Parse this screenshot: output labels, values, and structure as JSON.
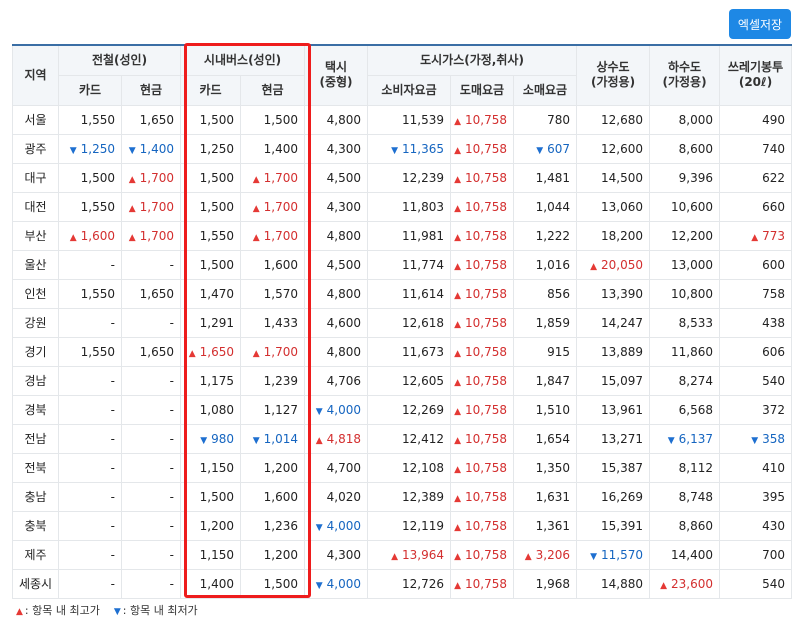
{
  "toolbar": {
    "excel_label": "엑셀저장"
  },
  "headers": {
    "region": "지역",
    "subway": "전철(성인)",
    "bus": "시내버스(성인)",
    "taxi": "택시\n(중형)",
    "gas": "도시가스(가정,취사)",
    "water": "상수도\n(가정용)",
    "sewer": "하수도\n(가정용)",
    "trash": "쓰레기봉투\n(20ℓ)",
    "card": "카드",
    "cash": "현금",
    "gas_consumer": "소비자요금",
    "gas_wholesale": "도매요금",
    "gas_retail": "소매요금"
  },
  "rows": [
    {
      "region": "서울",
      "cells": [
        {
          "v": "1,550"
        },
        {
          "v": "1,650"
        },
        {
          "v": "1,500"
        },
        {
          "v": "1,500"
        },
        {
          "v": "4,800"
        },
        {
          "v": "11,539"
        },
        {
          "v": "10,758",
          "m": "up"
        },
        {
          "v": "780"
        },
        {
          "v": "12,680"
        },
        {
          "v": "8,000"
        },
        {
          "v": "490"
        }
      ]
    },
    {
      "region": "광주",
      "cells": [
        {
          "v": "1,250",
          "m": "down"
        },
        {
          "v": "1,400",
          "m": "down"
        },
        {
          "v": "1,250"
        },
        {
          "v": "1,400"
        },
        {
          "v": "4,300"
        },
        {
          "v": "11,365",
          "m": "down"
        },
        {
          "v": "10,758",
          "m": "up"
        },
        {
          "v": "607",
          "m": "down"
        },
        {
          "v": "12,600"
        },
        {
          "v": "8,600"
        },
        {
          "v": "740"
        }
      ]
    },
    {
      "region": "대구",
      "cells": [
        {
          "v": "1,500"
        },
        {
          "v": "1,700",
          "m": "up"
        },
        {
          "v": "1,500"
        },
        {
          "v": "1,700",
          "m": "up"
        },
        {
          "v": "4,500"
        },
        {
          "v": "12,239"
        },
        {
          "v": "10,758",
          "m": "up"
        },
        {
          "v": "1,481"
        },
        {
          "v": "14,500"
        },
        {
          "v": "9,396"
        },
        {
          "v": "622"
        }
      ]
    },
    {
      "region": "대전",
      "cells": [
        {
          "v": "1,550"
        },
        {
          "v": "1,700",
          "m": "up"
        },
        {
          "v": "1,500"
        },
        {
          "v": "1,700",
          "m": "up"
        },
        {
          "v": "4,300"
        },
        {
          "v": "11,803"
        },
        {
          "v": "10,758",
          "m": "up"
        },
        {
          "v": "1,044"
        },
        {
          "v": "13,060"
        },
        {
          "v": "10,600"
        },
        {
          "v": "660"
        }
      ]
    },
    {
      "region": "부산",
      "cells": [
        {
          "v": "1,600",
          "m": "up"
        },
        {
          "v": "1,700",
          "m": "up"
        },
        {
          "v": "1,550"
        },
        {
          "v": "1,700",
          "m": "up"
        },
        {
          "v": "4,800"
        },
        {
          "v": "11,981"
        },
        {
          "v": "10,758",
          "m": "up"
        },
        {
          "v": "1,222"
        },
        {
          "v": "18,200"
        },
        {
          "v": "12,200"
        },
        {
          "v": "773",
          "m": "up"
        }
      ]
    },
    {
      "region": "울산",
      "cells": [
        {
          "v": "-"
        },
        {
          "v": "-"
        },
        {
          "v": "1,500"
        },
        {
          "v": "1,600"
        },
        {
          "v": "4,500"
        },
        {
          "v": "11,774"
        },
        {
          "v": "10,758",
          "m": "up"
        },
        {
          "v": "1,016"
        },
        {
          "v": "20,050",
          "m": "up"
        },
        {
          "v": "13,000"
        },
        {
          "v": "600"
        }
      ]
    },
    {
      "region": "인천",
      "cells": [
        {
          "v": "1,550"
        },
        {
          "v": "1,650"
        },
        {
          "v": "1,470"
        },
        {
          "v": "1,570"
        },
        {
          "v": "4,800"
        },
        {
          "v": "11,614"
        },
        {
          "v": "10,758",
          "m": "up"
        },
        {
          "v": "856"
        },
        {
          "v": "13,390"
        },
        {
          "v": "10,800"
        },
        {
          "v": "758"
        }
      ]
    },
    {
      "region": "강원",
      "cells": [
        {
          "v": "-"
        },
        {
          "v": "-"
        },
        {
          "v": "1,291"
        },
        {
          "v": "1,433"
        },
        {
          "v": "4,600"
        },
        {
          "v": "12,618"
        },
        {
          "v": "10,758",
          "m": "up"
        },
        {
          "v": "1,859"
        },
        {
          "v": "14,247"
        },
        {
          "v": "8,533"
        },
        {
          "v": "438"
        }
      ]
    },
    {
      "region": "경기",
      "cells": [
        {
          "v": "1,550"
        },
        {
          "v": "1,650"
        },
        {
          "v": "1,650",
          "m": "up"
        },
        {
          "v": "1,700",
          "m": "up"
        },
        {
          "v": "4,800"
        },
        {
          "v": "11,673"
        },
        {
          "v": "10,758",
          "m": "up"
        },
        {
          "v": "915"
        },
        {
          "v": "13,889"
        },
        {
          "v": "11,860"
        },
        {
          "v": "606"
        }
      ]
    },
    {
      "region": "경남",
      "cells": [
        {
          "v": "-"
        },
        {
          "v": "-"
        },
        {
          "v": "1,175"
        },
        {
          "v": "1,239"
        },
        {
          "v": "4,706"
        },
        {
          "v": "12,605"
        },
        {
          "v": "10,758",
          "m": "up"
        },
        {
          "v": "1,847"
        },
        {
          "v": "15,097"
        },
        {
          "v": "8,274"
        },
        {
          "v": "540"
        }
      ]
    },
    {
      "region": "경북",
      "cells": [
        {
          "v": "-"
        },
        {
          "v": "-"
        },
        {
          "v": "1,080"
        },
        {
          "v": "1,127"
        },
        {
          "v": "4,000",
          "m": "down"
        },
        {
          "v": "12,269"
        },
        {
          "v": "10,758",
          "m": "up"
        },
        {
          "v": "1,510"
        },
        {
          "v": "13,961"
        },
        {
          "v": "6,568"
        },
        {
          "v": "372"
        }
      ]
    },
    {
      "region": "전남",
      "cells": [
        {
          "v": "-"
        },
        {
          "v": "-"
        },
        {
          "v": "980",
          "m": "down"
        },
        {
          "v": "1,014",
          "m": "down"
        },
        {
          "v": "4,818",
          "m": "up"
        },
        {
          "v": "12,412"
        },
        {
          "v": "10,758",
          "m": "up"
        },
        {
          "v": "1,654"
        },
        {
          "v": "13,271"
        },
        {
          "v": "6,137",
          "m": "down"
        },
        {
          "v": "358",
          "m": "down"
        }
      ]
    },
    {
      "region": "전북",
      "cells": [
        {
          "v": "-"
        },
        {
          "v": "-"
        },
        {
          "v": "1,150"
        },
        {
          "v": "1,200"
        },
        {
          "v": "4,700"
        },
        {
          "v": "12,108"
        },
        {
          "v": "10,758",
          "m": "up"
        },
        {
          "v": "1,350"
        },
        {
          "v": "15,387"
        },
        {
          "v": "8,112"
        },
        {
          "v": "410"
        }
      ]
    },
    {
      "region": "충남",
      "cells": [
        {
          "v": "-"
        },
        {
          "v": "-"
        },
        {
          "v": "1,500"
        },
        {
          "v": "1,600"
        },
        {
          "v": "4,020"
        },
        {
          "v": "12,389"
        },
        {
          "v": "10,758",
          "m": "up"
        },
        {
          "v": "1,631"
        },
        {
          "v": "16,269"
        },
        {
          "v": "8,748"
        },
        {
          "v": "395"
        }
      ]
    },
    {
      "region": "충북",
      "cells": [
        {
          "v": "-"
        },
        {
          "v": "-"
        },
        {
          "v": "1,200"
        },
        {
          "v": "1,236"
        },
        {
          "v": "4,000",
          "m": "down"
        },
        {
          "v": "12,119"
        },
        {
          "v": "10,758",
          "m": "up"
        },
        {
          "v": "1,361"
        },
        {
          "v": "15,391"
        },
        {
          "v": "8,860"
        },
        {
          "v": "430"
        }
      ]
    },
    {
      "region": "제주",
      "cells": [
        {
          "v": "-"
        },
        {
          "v": "-"
        },
        {
          "v": "1,150"
        },
        {
          "v": "1,200"
        },
        {
          "v": "4,300"
        },
        {
          "v": "13,964",
          "m": "up"
        },
        {
          "v": "10,758",
          "m": "up"
        },
        {
          "v": "3,206",
          "m": "up"
        },
        {
          "v": "11,570",
          "m": "down"
        },
        {
          "v": "14,400"
        },
        {
          "v": "700"
        }
      ]
    },
    {
      "region": "세종시",
      "cells": [
        {
          "v": "-"
        },
        {
          "v": "-"
        },
        {
          "v": "1,400"
        },
        {
          "v": "1,500"
        },
        {
          "v": "4,000",
          "m": "down"
        },
        {
          "v": "12,726"
        },
        {
          "v": "10,758",
          "m": "up"
        },
        {
          "v": "1,968"
        },
        {
          "v": "14,880"
        },
        {
          "v": "23,600",
          "m": "up"
        },
        {
          "v": "540"
        }
      ]
    }
  ],
  "legend": {
    "up_label": ": 항목 내 최고가",
    "down_label": ": 항목 내 최저가"
  },
  "colors": {
    "accent": "#1e88e5",
    "high": "#d32f2f",
    "low": "#1565c0",
    "highlight": "#ee1c1c"
  },
  "icons": {
    "up": "triangle-up-icon",
    "down": "triangle-down-icon"
  }
}
